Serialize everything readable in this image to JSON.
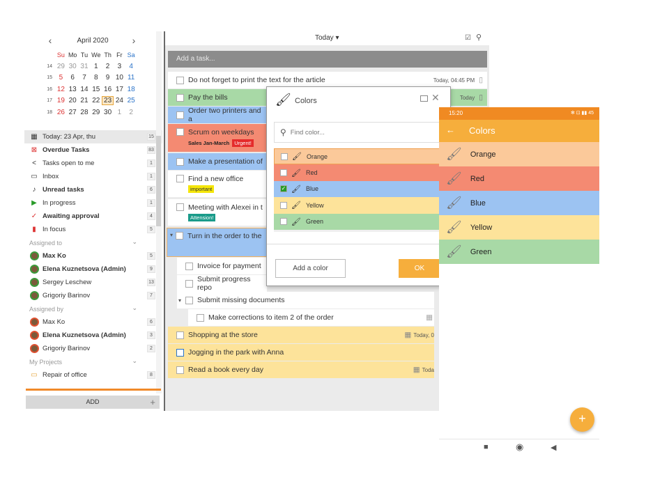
{
  "calendar": {
    "prev": "‹",
    "next": "›",
    "month": "April 2020",
    "weekdays": [
      "Su",
      "Mo",
      "Tu",
      "We",
      "Th",
      "Fr",
      "Sa"
    ],
    "weeks": [
      {
        "wk": "14",
        "days": [
          "29",
          "30",
          "31",
          "1",
          "2",
          "3",
          "4"
        ]
      },
      {
        "wk": "15",
        "days": [
          "5",
          "6",
          "7",
          "8",
          "9",
          "10",
          "11"
        ]
      },
      {
        "wk": "16",
        "days": [
          "12",
          "13",
          "14",
          "15",
          "16",
          "17",
          "18"
        ]
      },
      {
        "wk": "17",
        "days": [
          "19",
          "20",
          "21",
          "22",
          "23",
          "24",
          "25"
        ]
      },
      {
        "wk": "18",
        "days": [
          "26",
          "27",
          "28",
          "29",
          "30",
          "1",
          "2"
        ]
      }
    ]
  },
  "menu": {
    "today": {
      "label": "Today: 23 Apr, thu",
      "count": "15"
    },
    "overdue": {
      "label": "Overdue Tasks",
      "count": "83"
    },
    "open": {
      "label": "Tasks open to me",
      "count": "1"
    },
    "inbox": {
      "label": "Inbox",
      "count": "1"
    },
    "unread": {
      "label": "Unread tasks",
      "count": "6"
    },
    "progress": {
      "label": "In progress",
      "count": "1"
    },
    "approval": {
      "label": "Awaiting approval",
      "count": "4"
    },
    "focus": {
      "label": "In focus",
      "count": "5"
    },
    "assigned_to": "Assigned to",
    "to": [
      {
        "name": "Max Ko",
        "count": "5"
      },
      {
        "name": "Elena Kuznetsova (Admin)",
        "count": "9"
      },
      {
        "name": "Sergey Leschew",
        "count": "13"
      },
      {
        "name": "Grigoriy Barinov",
        "count": "7"
      }
    ],
    "assigned_by": "Assigned by",
    "by": [
      {
        "name": "Max Ko",
        "count": "6"
      },
      {
        "name": "Elena Kuznetsova (Admin)",
        "count": "3"
      },
      {
        "name": "Grigoriy Barinov",
        "count": "2"
      }
    ],
    "projects": "My Projects",
    "repair": {
      "label": "Repair of office",
      "count": "8"
    },
    "add": "ADD",
    "add_plus": "+"
  },
  "main": {
    "view": "Today ▾",
    "placeholder": "Add a task...",
    "tasks": [
      {
        "title": "Do not forget to print the text for the article",
        "date": "Today, 04:45 PM"
      },
      {
        "title": "Pay the bills",
        "date": "Today"
      },
      {
        "title": "Order two printers and a"
      },
      {
        "title": "Scrum on weekdays",
        "sub": "Sales Jan-March",
        "tag": "Urgent!"
      },
      {
        "title": "Make a presentation of"
      },
      {
        "title": "Find a new office",
        "tag": "important"
      },
      {
        "title": "Meeting with Alexei in t",
        "tag": "Attension!"
      },
      {
        "title": "Turn in the order to the"
      },
      {
        "title": "Invoice for payment"
      },
      {
        "title": "Submit progress repo"
      },
      {
        "title": "Submit missing documents"
      },
      {
        "title": "Make corrections to item 2 of the order"
      },
      {
        "title": "Shopping at the store",
        "date": "Today, 0"
      },
      {
        "title": "Jogging in the park with Anna"
      },
      {
        "title": "Read a book every day",
        "date": "Toda"
      }
    ]
  },
  "dialog": {
    "title": "Colors",
    "search_placeholder": "Find color...",
    "colors": [
      {
        "name": "Orange",
        "hex": "#fbc99a"
      },
      {
        "name": "Red",
        "hex": "#f48a72"
      },
      {
        "name": "Blue",
        "hex": "#9cc3f2"
      },
      {
        "name": "Yellow",
        "hex": "#fde39a"
      },
      {
        "name": "Green",
        "hex": "#a8d9a6"
      }
    ],
    "add": "Add a color",
    "ok": "OK"
  },
  "phone": {
    "time": "15:20",
    "status_right": "✻ ⊡ ▮▮ 45",
    "title": "Colors",
    "back": "←",
    "colors": [
      "Orange",
      "Red",
      "Blue",
      "Yellow",
      "Green"
    ],
    "fab": "+"
  }
}
